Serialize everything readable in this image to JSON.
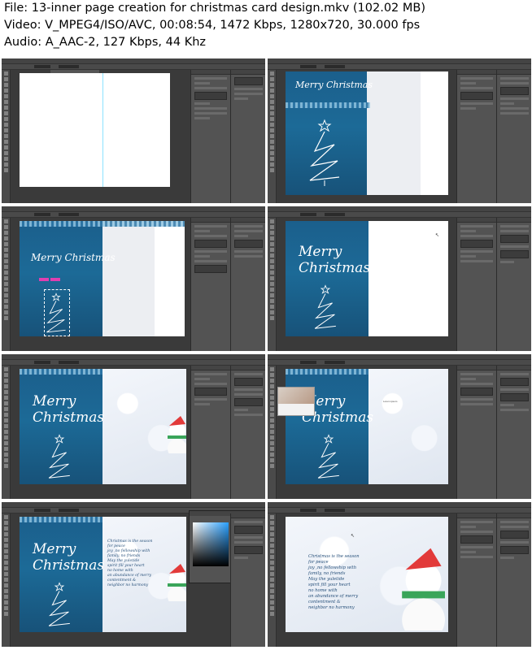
{
  "header": {
    "file_line": "File: 13-inner page creation for christmas card design.mkv (102.02 MB)",
    "video_line": "Video: V_MPEG4/ISO/AVC, 00:08:54, 1472 Kbps, 1280x720, 30.000 fps",
    "audio_line": "Audio: A_AAC-2, 127 Kbps, 44 Khz"
  },
  "card": {
    "merry": "Merry",
    "christmas": "Christmas"
  },
  "verse_lines": [
    "Christmas is the season",
    "for peace",
    "joy ,no fellowship with",
    "family, no friends",
    "May the yuletide",
    "spirit fill your heart",
    "no home with",
    "an abundance of merry",
    "contentment &",
    "neighbor no harmony"
  ],
  "lorem_text": "Lorem ipsum",
  "colors": {
    "ps_dark": "#3a3a3a",
    "ps_panel": "#535353",
    "card_blue": "#1c6a97",
    "snow": "#eceef2",
    "guide": "#3fd0ff"
  }
}
